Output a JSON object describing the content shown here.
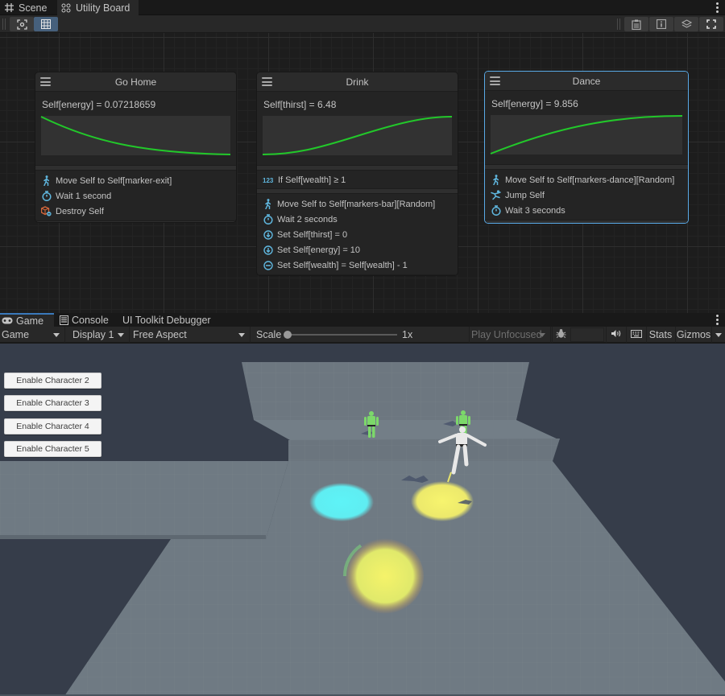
{
  "editor_tabs": [
    {
      "label": "Scene",
      "icon": "grid-hash-icon",
      "active": false
    },
    {
      "label": "Utility Board",
      "icon": "utility-board-icon",
      "active": true
    }
  ],
  "board_toolbar": {
    "left_buttons": [
      {
        "icon": "frame-focus-icon",
        "active": false
      },
      {
        "icon": "grid-toggle-icon",
        "active": true
      }
    ],
    "right_buttons": [
      {
        "icon": "clipboard-icon"
      },
      {
        "icon": "info-icon"
      },
      {
        "icon": "layers-icon"
      },
      {
        "icon": "maximize-icon"
      }
    ]
  },
  "cards": [
    {
      "title": "Go Home",
      "expression": "Self[energy] = 0.07218659",
      "curve": "decreasing-ease-out",
      "selected": false,
      "conditions": [],
      "actions": [
        {
          "icon": "walk-icon",
          "text": "Move Self to Self[marker-exit]"
        },
        {
          "icon": "stopwatch-icon",
          "text": "Wait 1 second"
        },
        {
          "icon": "destroy-icon",
          "text": "Destroy Self"
        }
      ]
    },
    {
      "title": "Drink",
      "expression": "Self[thirst] = 6.48",
      "curve": "increasing-s-curve",
      "selected": false,
      "conditions": [
        {
          "icon": "number-123-icon",
          "text": "If Self[wealth] ≥ 1"
        }
      ],
      "actions": [
        {
          "icon": "walk-icon",
          "text": "Move Self to Self[markers-bar][Random]"
        },
        {
          "icon": "stopwatch-icon",
          "text": "Wait 2 seconds"
        },
        {
          "icon": "set-down-icon",
          "text": "Set Self[thirst] = 0"
        },
        {
          "icon": "set-down-icon",
          "text": "Set Self[energy] = 10"
        },
        {
          "icon": "minus-circle-icon",
          "text": "Set Self[wealth] = Self[wealth] - 1"
        }
      ]
    },
    {
      "title": "Dance",
      "expression": "Self[energy] = 9.856",
      "curve": "increasing-ease-out",
      "selected": true,
      "conditions": [],
      "actions": [
        {
          "icon": "walk-icon",
          "text": "Move Self to Self[markers-dance][Random]"
        },
        {
          "icon": "jump-icon",
          "text": "Jump Self"
        },
        {
          "icon": "stopwatch-icon",
          "text": "Wait 3 seconds"
        }
      ]
    }
  ],
  "game_tabs": [
    {
      "label": "Game",
      "icon": "gamepad-icon",
      "active": true
    },
    {
      "label": "Console",
      "icon": "console-icon",
      "active": false
    },
    {
      "label": "UI Toolkit Debugger",
      "icon": "",
      "active": false
    }
  ],
  "game_toolbar": {
    "mode": "Game",
    "display": "Display 1",
    "aspect": "Free Aspect",
    "scale_label": "Scale",
    "scale_value": "1x",
    "scale_fraction": 0.0,
    "play_mode": "Play Unfocused",
    "stats_label": "Stats",
    "gizmos_label": "Gizmos"
  },
  "game_ui_buttons": [
    "Enable Character 2",
    "Enable Character 3",
    "Enable Character 4",
    "Enable Character 5"
  ],
  "colors": {
    "curve": "#22c82a",
    "icon_accent": "#5fb6de",
    "destroy_accent": "#d8683c",
    "selection": "#59a9e6",
    "light_cyan": "#5ef3f7",
    "light_yellow": "#f3ef6a"
  }
}
